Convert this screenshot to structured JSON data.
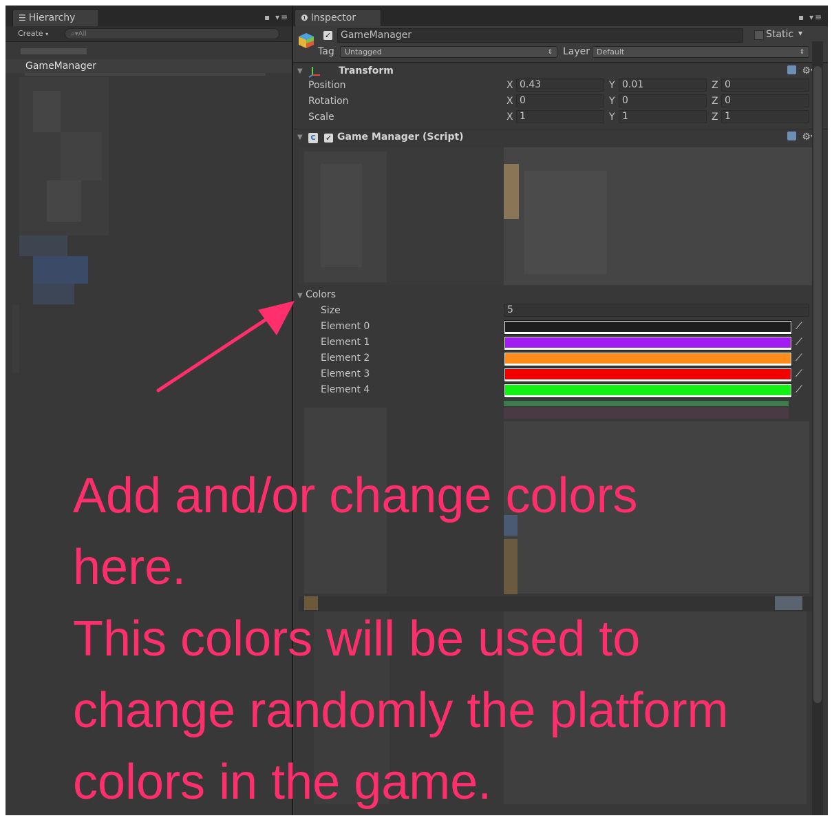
{
  "hierarchy": {
    "tab_title": "Hierarchy",
    "create_label": "Create",
    "search_placeholder": "All",
    "selected_item": "GameManager"
  },
  "inspector": {
    "tab_title": "Inspector",
    "object_name": "GameManager",
    "object_active": true,
    "static_label": "Static",
    "tag_label": "Tag",
    "tag_value": "Untagged",
    "layer_label": "Layer",
    "layer_value": "Default",
    "transform": {
      "title": "Transform",
      "rows": [
        {
          "label": "Position",
          "x": "0.43",
          "y": "0.01",
          "z": "0"
        },
        {
          "label": "Rotation",
          "x": "0",
          "y": "0",
          "z": "0"
        },
        {
          "label": "Scale",
          "x": "1",
          "y": "1",
          "z": "1"
        }
      ],
      "axis_x": "X",
      "axis_y": "Y",
      "axis_z": "Z"
    },
    "script": {
      "title": "Game Manager (Script)",
      "enabled": true
    },
    "colors": {
      "label": "Colors",
      "size_label": "Size",
      "size_value": "5",
      "elements": [
        {
          "label": "Element 0",
          "color": "#1e1e1e"
        },
        {
          "label": "Element 1",
          "color": "#a11cf0"
        },
        {
          "label": "Element 2",
          "color": "#ff8c1a"
        },
        {
          "label": "Element 3",
          "color": "#f20000"
        },
        {
          "label": "Element 4",
          "color": "#14f014"
        }
      ]
    }
  },
  "annotation": {
    "lines": [
      "Add and/or change colors",
      "here.",
      "This colors will be used to",
      "change randomly the platform",
      "colors in the game."
    ],
    "color": "#ff2f6e"
  }
}
